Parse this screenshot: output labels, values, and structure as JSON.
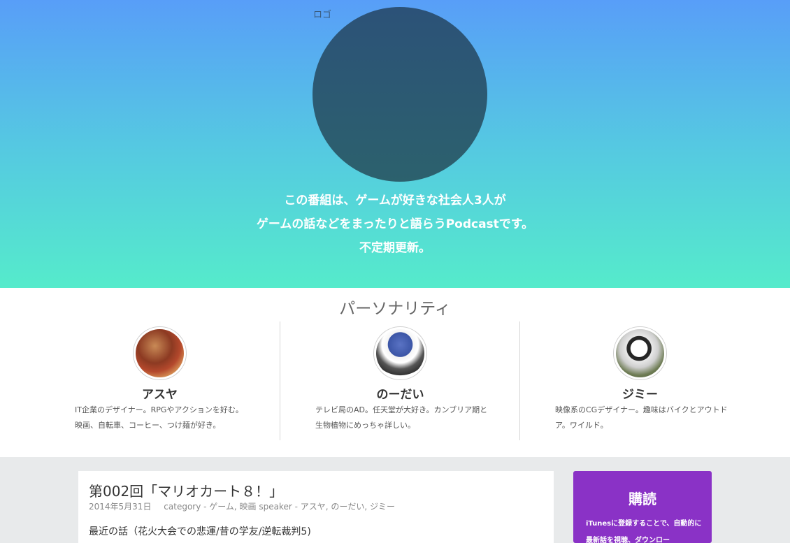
{
  "hero": {
    "logo_alt": "ロゴ",
    "tagline": [
      "この番組は、ゲームが好きな社会人3人が",
      "ゲームの話などをまったりと語らうPodcastです。",
      "不定期更新。"
    ]
  },
  "personality": {
    "title": "パーソナリティ",
    "members": [
      {
        "name": "アスヤ",
        "desc": "IT企業のデザイナー。RPGやアクションを好む。映画、自転車、コーヒー、つけ麺が好き。"
      },
      {
        "name": "のーだい",
        "desc": "テレビ局のAD。任天堂が大好き。カンブリア期と生物植物にめっちゃ詳しい。"
      },
      {
        "name": "ジミー",
        "desc": "映像系のCGデザイナー。趣味はバイクとアウトドア。ワイルド。"
      }
    ]
  },
  "post": {
    "title": "第002回「マリオカート８！」",
    "date": "2014年5月31日",
    "category": "category - ゲーム, 映画 speaker - アスヤ, のーだい, ジミー",
    "body": "最近の話（花火大会での悲運/昔の学友/逆転裁判5)"
  },
  "subscribe": {
    "title": "購読",
    "desc": "iTunesに登録することで、自動的に最新話を視聴、ダウンロー"
  },
  "colors": {
    "hero_top": "#589ef8",
    "hero_bottom": "#55ebcb",
    "logo": "#2c5a72",
    "subscribe_bg": "#8a32c6"
  }
}
